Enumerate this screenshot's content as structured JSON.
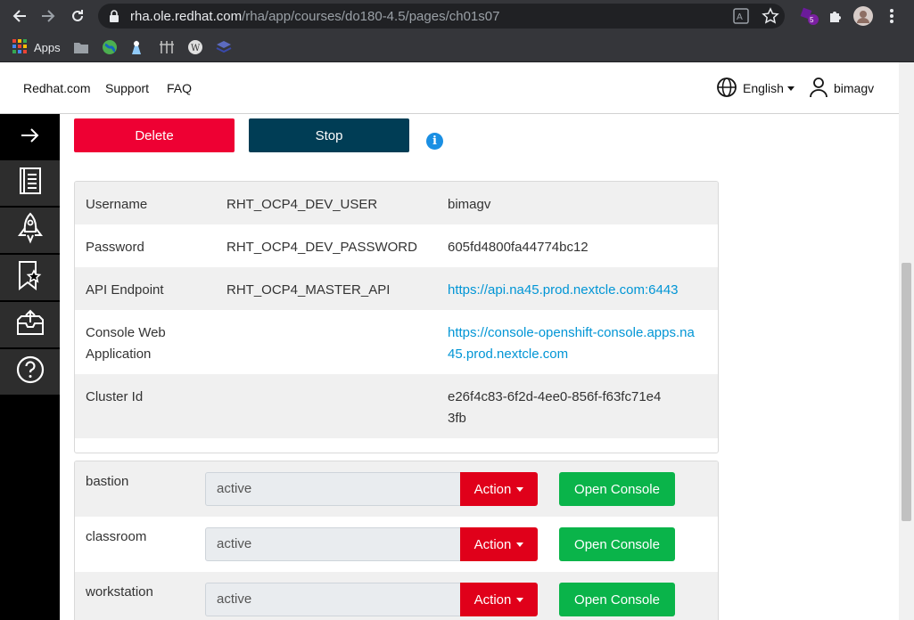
{
  "browser": {
    "url_host": "rha.ole.redhat.com",
    "url_path": "/rha/app/courses/do180-4.5/pages/ch01s07",
    "extension_badge": "5",
    "bookmarks": [
      {
        "label": "Apps",
        "icon": "apps-grid-icon"
      },
      {
        "label": "",
        "icon": "folder-icon"
      },
      {
        "label": "",
        "icon": "globe-icon"
      },
      {
        "label": "",
        "icon": "bookmark-icon"
      },
      {
        "label": "",
        "icon": "bookmark-icon"
      },
      {
        "label": "",
        "icon": "wikipedia-icon"
      },
      {
        "label": "",
        "icon": "layers-icon"
      }
    ]
  },
  "header": {
    "links": [
      "Redhat.com",
      "Support",
      "FAQ"
    ],
    "language": "English",
    "username": "bimagv"
  },
  "sidebar": {
    "items": [
      {
        "icon": "arrow-right-icon"
      },
      {
        "icon": "book-icon"
      },
      {
        "icon": "rocket-icon"
      },
      {
        "icon": "bookmark-star-icon"
      },
      {
        "icon": "inbox-upload-icon"
      },
      {
        "icon": "help-icon"
      }
    ]
  },
  "controls": {
    "delete_label": "Delete",
    "stop_label": "Stop",
    "info_label": "i"
  },
  "credentials": {
    "rows": [
      {
        "label": "Username",
        "variable": "RHT_OCP4_DEV_USER",
        "value": "bimagv",
        "is_link": false
      },
      {
        "label": "Password",
        "variable": "RHT_OCP4_DEV_PASSWORD",
        "value": "605fd4800fa44774bc12",
        "is_link": false
      },
      {
        "label": "API Endpoint",
        "variable": "RHT_OCP4_MASTER_API",
        "value": "https://api.na45.prod.nextcle.com:6443",
        "is_link": true
      },
      {
        "label": "Console Web Application",
        "variable": "",
        "value": "https://console-openshift-console.apps.na45.prod.nextcle.com",
        "is_link": true
      },
      {
        "label": "Cluster Id",
        "variable": "",
        "value": "e26f4c83-6f2d-4ee0-856f-f63fc71e43fb",
        "is_link": false
      }
    ]
  },
  "vms": {
    "action_label": "Action",
    "open_console_label": "Open Console",
    "rows": [
      {
        "name": "bastion",
        "state": "active"
      },
      {
        "name": "classroom",
        "state": "active"
      },
      {
        "name": "workstation",
        "state": "active"
      }
    ]
  }
}
